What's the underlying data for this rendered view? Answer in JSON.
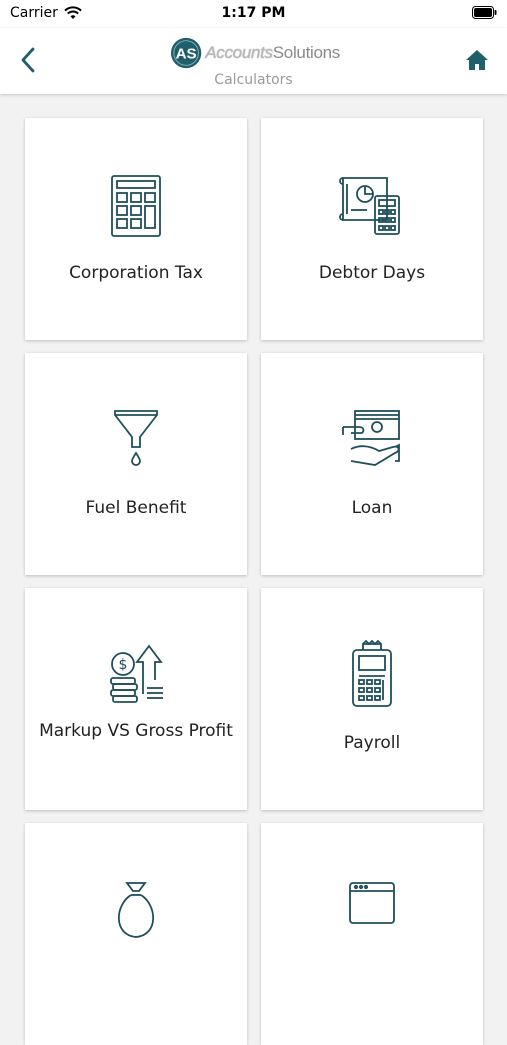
{
  "status_bar": {
    "carrier": "Carrier",
    "time": "1:17 PM"
  },
  "header": {
    "logo_text_part1": "Accounts",
    "logo_text_part2": "Solutions",
    "logo_badge": "AS",
    "title": "Calculators",
    "back_icon": "chevron-left-icon",
    "home_icon": "home-icon"
  },
  "colors": {
    "accent": "#1f5f6b",
    "icon_stroke": "#1f4f5b"
  },
  "calculators": [
    {
      "label": "Corporation Tax",
      "icon": "calculator-icon"
    },
    {
      "label": "Debtor Days",
      "icon": "invoice-calculator-icon"
    },
    {
      "label": "Fuel Benefit",
      "icon": "funnel-icon"
    },
    {
      "label": "Loan",
      "icon": "cash-hand-icon"
    },
    {
      "label": "Markup VS Gross Profit",
      "icon": "coins-arrow-up-icon"
    },
    {
      "label": "Payroll",
      "icon": "payment-terminal-icon"
    },
    {
      "label": "",
      "icon": "money-bag-icon"
    },
    {
      "label": "",
      "icon": "browser-window-icon"
    }
  ]
}
